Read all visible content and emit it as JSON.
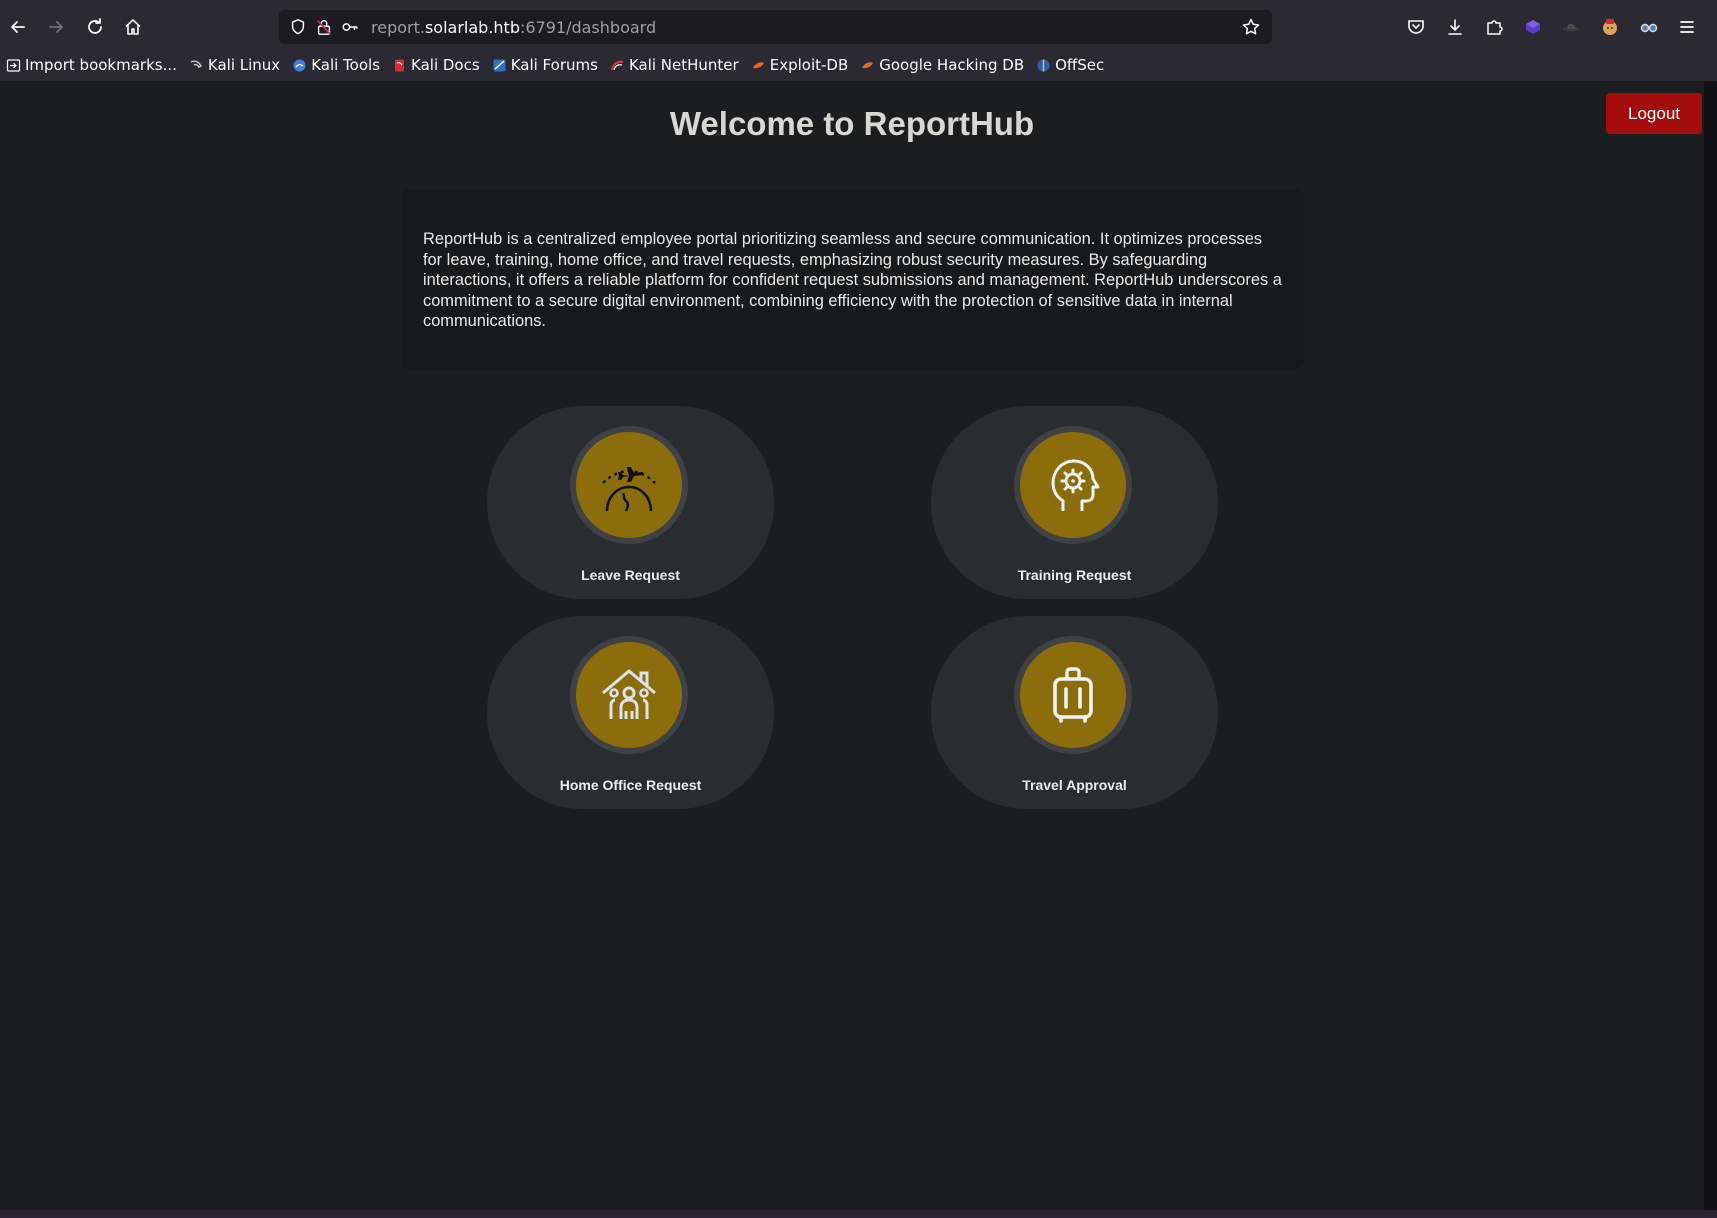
{
  "browser": {
    "url": {
      "prefix": "report.",
      "host": "solarlab.htb",
      "suffix": ":6791/dashboard"
    },
    "bookmarks": [
      {
        "label": "Import bookmarks...",
        "icon": "import-icon"
      },
      {
        "label": "Kali Linux",
        "icon": "kali-dragon-icon"
      },
      {
        "label": "Kali Tools",
        "icon": "kali-tools-icon"
      },
      {
        "label": "Kali Docs",
        "icon": "kali-docs-icon"
      },
      {
        "label": "Kali Forums",
        "icon": "kali-forums-icon"
      },
      {
        "label": "Kali NetHunter",
        "icon": "kali-nethunter-icon"
      },
      {
        "label": "Exploit-DB",
        "icon": "exploit-db-icon"
      },
      {
        "label": "Google Hacking DB",
        "icon": "ghdb-icon"
      },
      {
        "label": "OffSec",
        "icon": "offsec-icon"
      }
    ]
  },
  "page": {
    "title": "Welcome to ReportHub",
    "logout_label": "Logout",
    "intro": "ReportHub is a centralized employee portal prioritizing seamless and secure communication. It optimizes processes for leave, training, home office, and travel requests, emphasizing robust security measures. By safeguarding interactions, it offers a reliable platform for confident request submissions and management. ReportHub underscores a commitment to a secure digital environment, combining efficiency with the protection of sensitive data in internal communications.",
    "cards": [
      {
        "label": "Leave Request",
        "icon": "plane-over-globe-icon"
      },
      {
        "label": "Training Request",
        "icon": "head-gear-icon"
      },
      {
        "label": "Home Office Request",
        "icon": "home-family-icon"
      },
      {
        "label": "Travel Approval",
        "icon": "luggage-icon"
      }
    ]
  },
  "colors": {
    "background": "#1c1d1f",
    "accent_gold": "#8c6d0b",
    "logout_red": "#a30d0d",
    "card": "#2a2d30"
  }
}
